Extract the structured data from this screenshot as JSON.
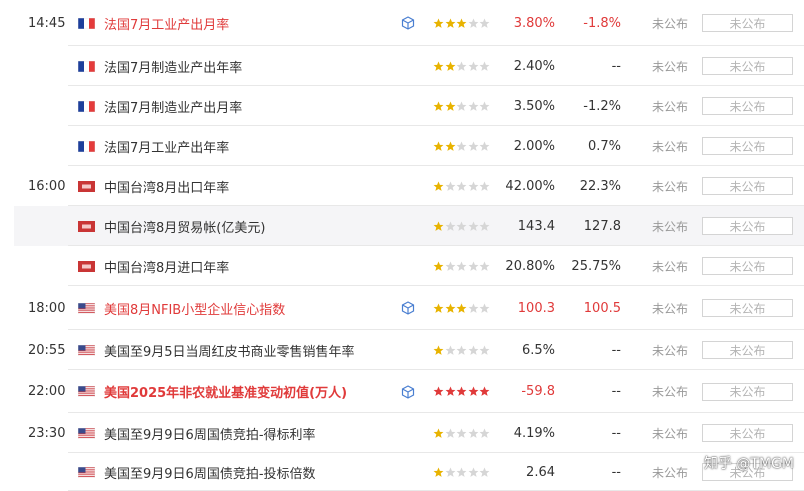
{
  "rows": [
    {
      "time": "14:45",
      "flag": "france",
      "name": "法国7月工业产出月率",
      "important": true,
      "bold": false,
      "cube": true,
      "stars": 3,
      "prev": "3.80%",
      "pred": "-1.8%",
      "actual": "未公布",
      "button": "未公布",
      "alt": false,
      "prev_red": true,
      "pred_red": true
    },
    {
      "time": "",
      "flag": "france",
      "name": "法国7月制造业产出年率",
      "important": false,
      "bold": false,
      "cube": false,
      "stars": 2,
      "prev": "2.40%",
      "pred": "--",
      "actual": "未公布",
      "button": "未公布",
      "alt": false,
      "prev_red": false,
      "pred_red": false
    },
    {
      "time": "",
      "flag": "france",
      "name": "法国7月制造业产出月率",
      "important": false,
      "bold": false,
      "cube": false,
      "stars": 2,
      "prev": "3.50%",
      "pred": "-1.2%",
      "actual": "未公布",
      "button": "未公布",
      "alt": false,
      "prev_red": false,
      "pred_red": false
    },
    {
      "time": "",
      "flag": "france",
      "name": "法国7月工业产出年率",
      "important": false,
      "bold": false,
      "cube": false,
      "stars": 2,
      "prev": "2.00%",
      "pred": "0.7%",
      "actual": "未公布",
      "button": "未公布",
      "alt": false,
      "prev_red": false,
      "pred_red": false
    },
    {
      "time": "16:00",
      "flag": "taiwan",
      "name": "中国台湾8月出口年率",
      "important": false,
      "bold": false,
      "cube": false,
      "stars": 1,
      "prev": "42.00%",
      "pred": "22.3%",
      "actual": "未公布",
      "button": "未公布",
      "alt": false,
      "prev_red": false,
      "pred_red": false
    },
    {
      "time": "",
      "flag": "taiwan",
      "name": "中国台湾8月贸易帐(亿美元)",
      "important": false,
      "bold": false,
      "cube": false,
      "stars": 1,
      "prev": "143.4",
      "pred": "127.8",
      "actual": "未公布",
      "button": "未公布",
      "alt": true,
      "prev_red": false,
      "pred_red": false
    },
    {
      "time": "",
      "flag": "taiwan",
      "name": "中国台湾8月进口年率",
      "important": false,
      "bold": false,
      "cube": false,
      "stars": 1,
      "prev": "20.80%",
      "pred": "25.75%",
      "actual": "未公布",
      "button": "未公布",
      "alt": false,
      "prev_red": false,
      "pred_red": false
    },
    {
      "time": "18:00",
      "flag": "usa",
      "name": "美国8月NFIB小型企业信心指数",
      "important": true,
      "bold": false,
      "cube": true,
      "stars": 3,
      "prev": "100.3",
      "pred": "100.5",
      "actual": "未公布",
      "button": "未公布",
      "alt": false,
      "prev_red": true,
      "pred_red": true
    },
    {
      "time": "20:55",
      "flag": "usa",
      "name": "美国至9月5日当周红皮书商业零售销售年率",
      "important": false,
      "bold": false,
      "cube": false,
      "stars": 1,
      "prev": "6.5%",
      "pred": "--",
      "actual": "未公布",
      "button": "未公布",
      "alt": false,
      "prev_red": false,
      "pred_red": false
    },
    {
      "time": "22:00",
      "flag": "usa",
      "name": "美国2025年非农就业基准变动初值(万人)",
      "important": true,
      "bold": true,
      "cube": true,
      "stars": 5,
      "prev": "-59.8",
      "pred": "--",
      "actual": "未公布",
      "button": "未公布",
      "alt": false,
      "prev_red": true,
      "pred_red": false
    },
    {
      "time": "23:30",
      "flag": "usa",
      "name": "美国至9月9日6周国债竞拍-得标利率",
      "important": false,
      "bold": false,
      "cube": false,
      "stars": 1,
      "prev": "4.19%",
      "pred": "--",
      "actual": "未公布",
      "button": "未公布",
      "alt": false,
      "prev_red": false,
      "pred_red": false
    },
    {
      "time": "",
      "flag": "usa",
      "name": "美国至9月9日6周国债竞拍-投标倍数",
      "important": false,
      "bold": false,
      "cube": false,
      "stars": 1,
      "prev": "2.64",
      "pred": "--",
      "actual": "未公布",
      "button": "未公布",
      "alt": false,
      "prev_red": false,
      "pred_red": false
    }
  ],
  "watermark": "知乎 @TMGM",
  "colors": {
    "important": "#e03a3a",
    "star_on": "#e8b300",
    "star_on_red": "#e03a3a",
    "star_off": "#d6d6d6",
    "cube": "#4a7fd1"
  }
}
